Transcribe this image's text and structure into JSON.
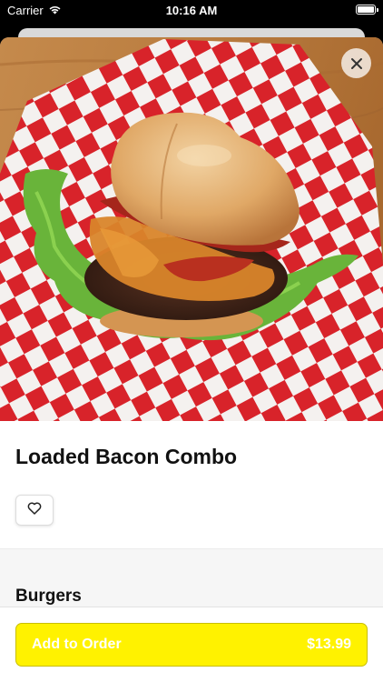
{
  "status_bar": {
    "carrier": "Carrier",
    "time": "10:16 AM",
    "wifi_icon": "wifi-icon",
    "battery_icon": "battery-icon"
  },
  "item": {
    "photo_alt": "Loaded bacon burger on checkered paper",
    "name": "Loaded Bacon Combo",
    "favorite_icon": "heart-icon",
    "close_icon": "close-icon"
  },
  "category": {
    "title": "Burgers"
  },
  "footer": {
    "add_label": "Add to Order",
    "price": "$13.99"
  },
  "colors": {
    "accent": "#fff200",
    "accent_border": "#c8be00",
    "section_bg": "#f6f6f6"
  }
}
